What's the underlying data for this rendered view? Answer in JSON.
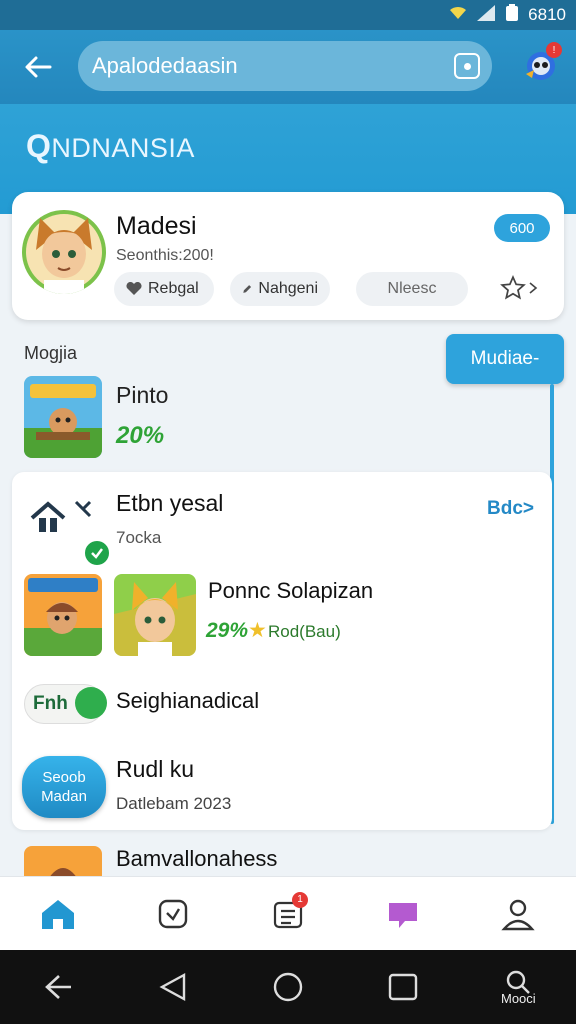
{
  "status_bar": {
    "time": "6810"
  },
  "search": {
    "value": "Apalodedaasin"
  },
  "brand": {
    "title": "NDNANSIA",
    "q_glyph": "Q"
  },
  "profile": {
    "name": "Madesi",
    "subtitle": "Seonthis:200!",
    "score": "600",
    "chips": [
      "Rebgal",
      "Nahgeni",
      "Nleesc"
    ]
  },
  "section": {
    "label": "Mogjia",
    "float_button": "Mudiae-"
  },
  "row_one": {
    "title": "Pinto",
    "percent": "20%"
  },
  "list": {
    "item1": {
      "title": "Etbn yesal",
      "subtitle": "7ocka",
      "link": "Bdc>"
    },
    "item2": {
      "title": "Ponnc Solapizan",
      "badge": "29%",
      "extra": "Rod(Bau)"
    },
    "item3": {
      "chip": "Fnh",
      "title": "Seighianadical"
    },
    "item4": {
      "button": "Seoob Madan",
      "title": "Rudl ku",
      "subtitle": "Datlebam 2023"
    }
  },
  "peek": {
    "title": "Bamvallonahess"
  },
  "bottom_nav": {
    "badge": "1"
  },
  "system_nav": {
    "search_label": "Mooci"
  },
  "colors": {
    "primary": "#2487bd",
    "accent": "#2ea3dc",
    "success": "#2ea336",
    "badge": "#e53935"
  }
}
